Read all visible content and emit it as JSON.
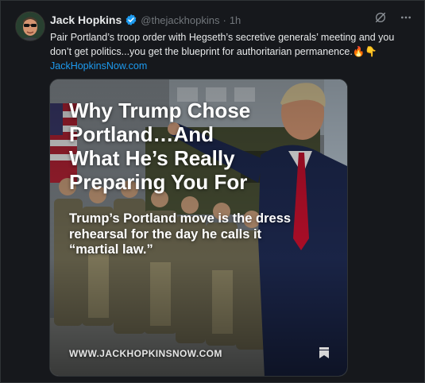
{
  "post": {
    "author_name": "Jack Hopkins",
    "handle": "@thejackhopkins",
    "separator": "·",
    "time": "1h",
    "text_line1": "Pair Portland’s troop order with Hegseth’s secretive generals’ meeting and you",
    "text_line2": "don’t get politics...you get the blueprint for authoritarian permanence.🔥👇",
    "link": "JackHopkinsNow.com"
  },
  "card": {
    "title_line1": "Why Trump Chose",
    "title_line2": "Portland…And",
    "title_line3": "What He’s Really",
    "title_line4": "Preparing You For",
    "subtitle_line1": "Trump’s Portland move is the dress",
    "subtitle_line2": "rehearsal for the day he calls it",
    "subtitle_line3": "“martial law.”",
    "domain": "WWW.JACKHOPKINSNOW.COM"
  },
  "icons": {
    "verified": "verified-badge-icon",
    "grok": "grok-icon",
    "more": "more-options-icon",
    "bookmark": "bookmark-icon"
  },
  "colors": {
    "background": "#16181c",
    "text": "#e7e9ea",
    "muted": "#71767b",
    "link": "#1d9bf0",
    "verified": "#1d9bf0"
  }
}
